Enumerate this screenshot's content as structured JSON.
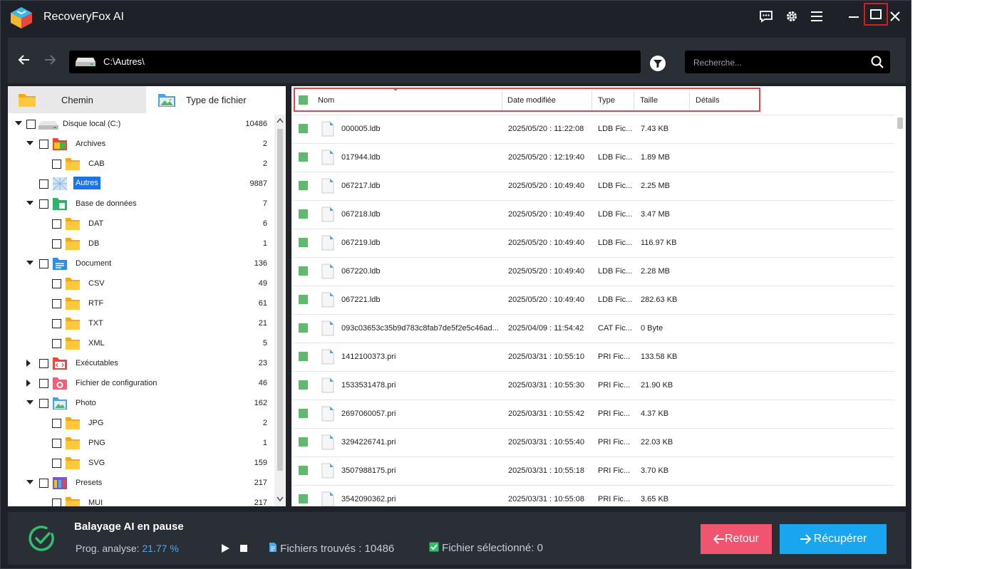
{
  "app": {
    "title": "RecoveryFox AI",
    "accent_color": "#1aa5f0",
    "header_icons": [
      "feedback-icon",
      "gear-icon",
      "menu-icon",
      "minimize-icon",
      "maximize-icon",
      "close-icon"
    ]
  },
  "address": {
    "path": "C:\\Autres\\",
    "search_placeholder": "Recherche..."
  },
  "left_tabs": [
    {
      "label": "Chemin"
    },
    {
      "label": "Type de fichier"
    }
  ],
  "tree": [
    {
      "label": "Disque local (C:)",
      "count": "10486",
      "arrow": "down",
      "level": 0,
      "icon": "drive"
    },
    {
      "label": "Archives",
      "count": "2",
      "arrow": "down",
      "level": 1,
      "icon": "archives"
    },
    {
      "label": "CAB",
      "count": "2",
      "arrow": "",
      "level": 2,
      "icon": "folder"
    },
    {
      "label": "Autres",
      "count": "9887",
      "arrow": "",
      "level": 1,
      "icon": "other",
      "selected": true
    },
    {
      "label": "Base de données",
      "count": "7",
      "arrow": "down",
      "level": 1,
      "icon": "database"
    },
    {
      "label": "DAT",
      "count": "6",
      "arrow": "",
      "level": 2,
      "icon": "folder"
    },
    {
      "label": "DB",
      "count": "1",
      "arrow": "",
      "level": 2,
      "icon": "folder"
    },
    {
      "label": "Document",
      "count": "136",
      "arrow": "down",
      "level": 1,
      "icon": "document"
    },
    {
      "label": "CSV",
      "count": "49",
      "arrow": "",
      "level": 2,
      "icon": "folder"
    },
    {
      "label": "RTF",
      "count": "61",
      "arrow": "",
      "level": 2,
      "icon": "folder"
    },
    {
      "label": "TXT",
      "count": "21",
      "arrow": "",
      "level": 2,
      "icon": "folder"
    },
    {
      "label": "XML",
      "count": "5",
      "arrow": "",
      "level": 2,
      "icon": "folder"
    },
    {
      "label": "Exécutables",
      "count": "23",
      "arrow": "right",
      "level": 1,
      "icon": "exec"
    },
    {
      "label": "Fichier de configuration",
      "count": "46",
      "arrow": "right",
      "level": 1,
      "icon": "config"
    },
    {
      "label": "Photo",
      "count": "162",
      "arrow": "down",
      "level": 1,
      "icon": "photo"
    },
    {
      "label": "JPG",
      "count": "2",
      "arrow": "",
      "level": 2,
      "icon": "folder"
    },
    {
      "label": "PNG",
      "count": "1",
      "arrow": "",
      "level": 2,
      "icon": "folder"
    },
    {
      "label": "SVG",
      "count": "159",
      "arrow": "",
      "level": 2,
      "icon": "folder"
    },
    {
      "label": "Presets",
      "count": "217",
      "arrow": "down",
      "level": 1,
      "icon": "presets"
    },
    {
      "label": "MUI",
      "count": "217",
      "arrow": "",
      "level": 2,
      "icon": "folder"
    }
  ],
  "columns": {
    "name": "Nom",
    "date": "Date modifiée",
    "type": "Type",
    "size": "Taille",
    "details": "Détails"
  },
  "files": [
    {
      "name": "000005.ldb",
      "date": "2025/05/20 : 11:22:08",
      "type": "LDB Fic...",
      "size": "7.43 KB"
    },
    {
      "name": "017944.ldb",
      "date": "2025/05/20 : 12:19:40",
      "type": "LDB Fic...",
      "size": "1.89 MB"
    },
    {
      "name": "067217.ldb",
      "date": "2025/05/20 : 10:49:40",
      "type": "LDB Fic...",
      "size": "2.25 MB"
    },
    {
      "name": "067218.ldb",
      "date": "2025/05/20 : 10:49:40",
      "type": "LDB Fic...",
      "size": "3.47 MB"
    },
    {
      "name": "067219.ldb",
      "date": "2025/05/20 : 10:49:40",
      "type": "LDB Fic...",
      "size": "116.97 KB"
    },
    {
      "name": "067220.ldb",
      "date": "2025/05/20 : 10:49:40",
      "type": "LDB Fic...",
      "size": "2.28 MB"
    },
    {
      "name": "067221.ldb",
      "date": "2025/05/20 : 10:49:40",
      "type": "LDB Fic...",
      "size": "282.63 KB"
    },
    {
      "name": "093c03653c35b9d783c8fab7de5f2e5c46ad...",
      "date": "2025/04/09 : 11:54:42",
      "type": "CAT Fic...",
      "size": "0 Byte"
    },
    {
      "name": "1412100373.pri",
      "date": "2025/03/31 : 10:55:10",
      "type": "PRI Fic...",
      "size": "133.58 KB"
    },
    {
      "name": "1533531478.pri",
      "date": "2025/03/31 : 10:55:30",
      "type": "PRI Fic...",
      "size": "21.90 KB"
    },
    {
      "name": "2697060057.pri",
      "date": "2025/03/31 : 10:55:42",
      "type": "PRI Fic...",
      "size": "4.37 KB"
    },
    {
      "name": "3294226741.pri",
      "date": "2025/03/31 : 10:55:40",
      "type": "PRI Fic...",
      "size": "22.03 KB"
    },
    {
      "name": "3507988175.pri",
      "date": "2025/03/31 : 10:55:18",
      "type": "PRI Fic...",
      "size": "3.70 KB"
    },
    {
      "name": "3542090362.pri",
      "date": "2025/03/31 : 10:55:08",
      "type": "PRI Fic...",
      "size": "3.65 KB"
    }
  ],
  "status": {
    "title": "Balayage AI en pause",
    "progress_label": "Prog. analyse:",
    "progress_value": "21.77 %",
    "found_text": "Fichiers trouvés : 10486",
    "selected_text": "Fichier sélectionné:  0"
  },
  "buttons": {
    "back": "Retour",
    "recover": "Récupérer"
  }
}
